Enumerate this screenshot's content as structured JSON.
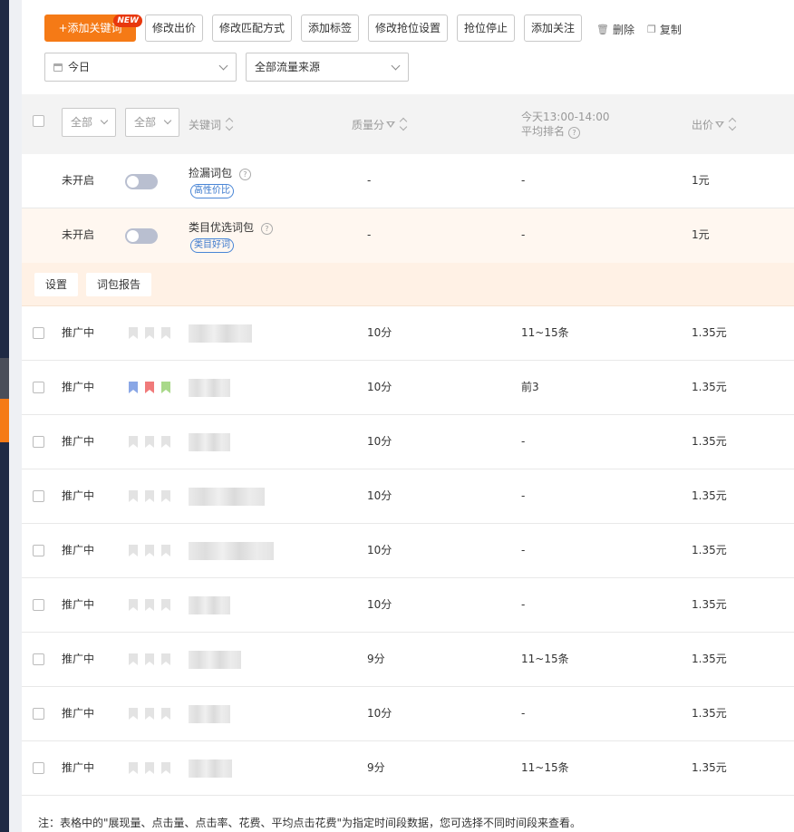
{
  "toolbar": {
    "add_keyword": "+添加关键词",
    "new_badge": "NEW",
    "buttons": [
      "修改出价",
      "修改匹配方式",
      "添加标签",
      "修改抢位设置",
      "抢位停止",
      "添加关注"
    ],
    "delete": "删除",
    "copy": "复制"
  },
  "filters": {
    "date": "今日",
    "traffic": "全部流量来源"
  },
  "table_header": {
    "status_filter": "全部",
    "flag_filter": "全部",
    "keyword": "关键词",
    "quality": "质量分",
    "rank_line1": "今天13:00-14:00",
    "rank_line2": "平均排名",
    "bid": "出价"
  },
  "packages": [
    {
      "status": "未开启",
      "name": "捡漏词包",
      "tag": "高性价比",
      "quality": "-",
      "rank": "-",
      "bid": "1元"
    },
    {
      "status": "未开启",
      "name": "类目优选词包",
      "tag": "类目好词",
      "quality": "-",
      "rank": "-",
      "bid": "1元"
    }
  ],
  "package_actions": {
    "settings": "设置",
    "report": "词包报告"
  },
  "rows": [
    {
      "status": "推广中",
      "quality": "10分",
      "rank": "11~15条",
      "bid": "1.35元"
    },
    {
      "status": "推广中",
      "quality": "10分",
      "rank": "前3",
      "bid": "1.35元"
    },
    {
      "status": "推广中",
      "quality": "10分",
      "rank": "-",
      "bid": "1.35元"
    },
    {
      "status": "推广中",
      "quality": "10分",
      "rank": "-",
      "bid": "1.35元"
    },
    {
      "status": "推广中",
      "quality": "10分",
      "rank": "-",
      "bid": "1.35元"
    },
    {
      "status": "推广中",
      "quality": "10分",
      "rank": "-",
      "bid": "1.35元"
    },
    {
      "status": "推广中",
      "quality": "9分",
      "rank": "11~15条",
      "bid": "1.35元"
    },
    {
      "status": "推广中",
      "quality": "10分",
      "rank": "-",
      "bid": "1.35元"
    },
    {
      "status": "推广中",
      "quality": "9分",
      "rank": "11~15条",
      "bid": "1.35元"
    }
  ],
  "colors": {
    "accent": "#f57a16",
    "status_active": "#3aa84b",
    "flag_blue": "#8aa7e6",
    "flag_red": "#f07a7a",
    "flag_green": "#a9d98a"
  },
  "footer_note": "注：表格中的\"展现量、点击量、点击率、花费、平均点击花费\"为指定时间段数据，您可选择不同时间段来查看。"
}
